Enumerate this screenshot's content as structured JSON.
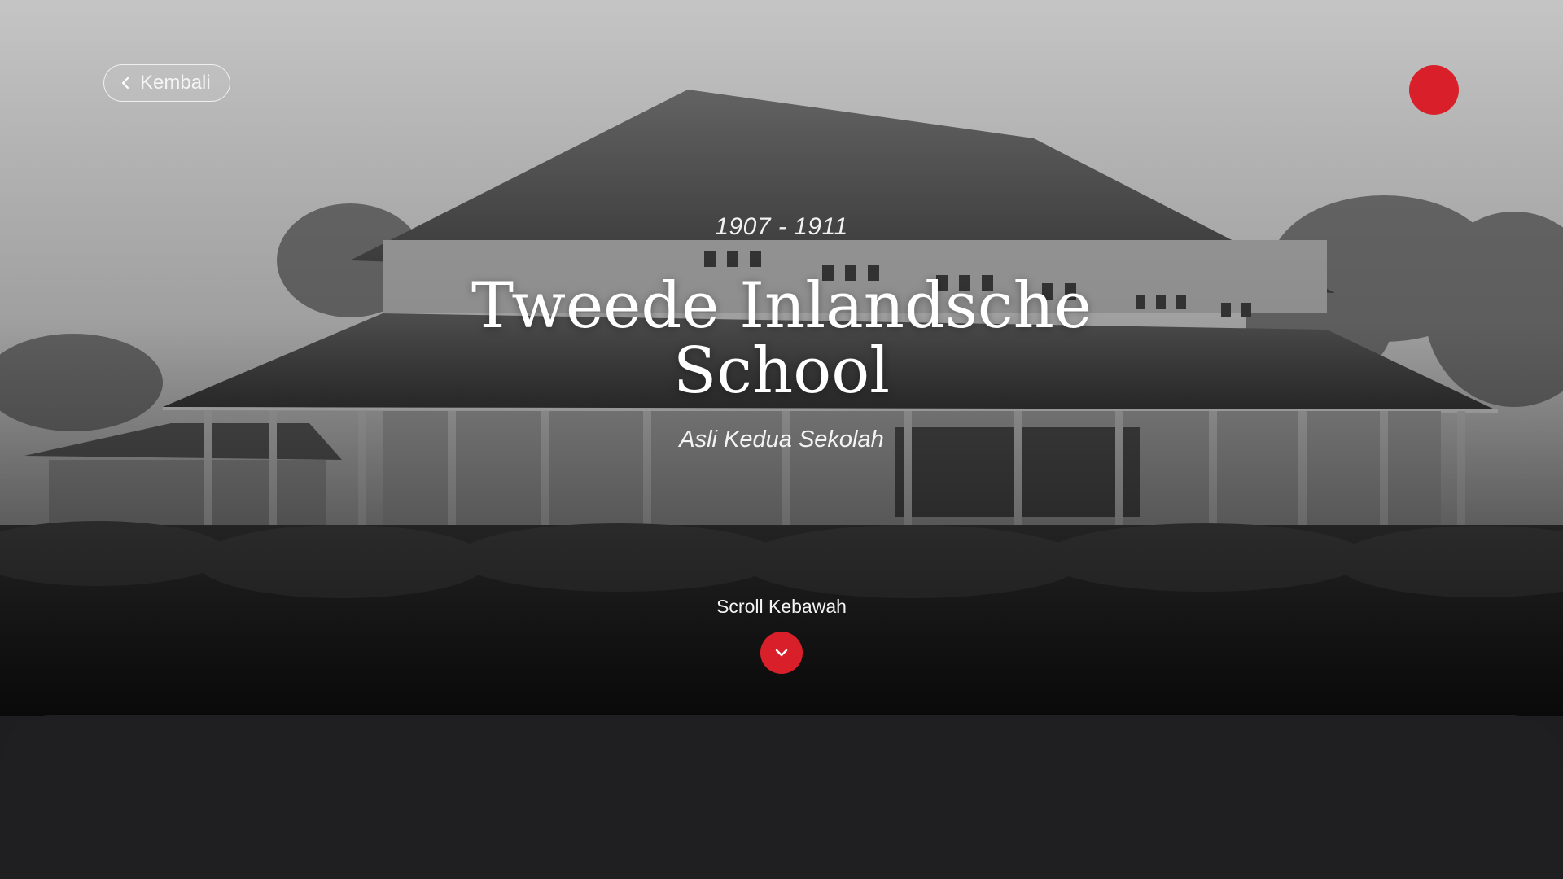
{
  "nav": {
    "back_label": "Kembali",
    "back_icon": "chevron-left-icon",
    "menu_icon": "menu-dot-icon"
  },
  "hero": {
    "years": "1907 - 1911",
    "title": "Tweede Inlandsche School",
    "subtitle": "Asli Kedua Sekolah",
    "scroll_label": "Scroll Kebawah",
    "scroll_icon": "chevron-down-icon"
  },
  "colors": {
    "accent": "#d9202a",
    "panel_dark": "#1f1f21",
    "panel_red": "#5a1c20"
  }
}
